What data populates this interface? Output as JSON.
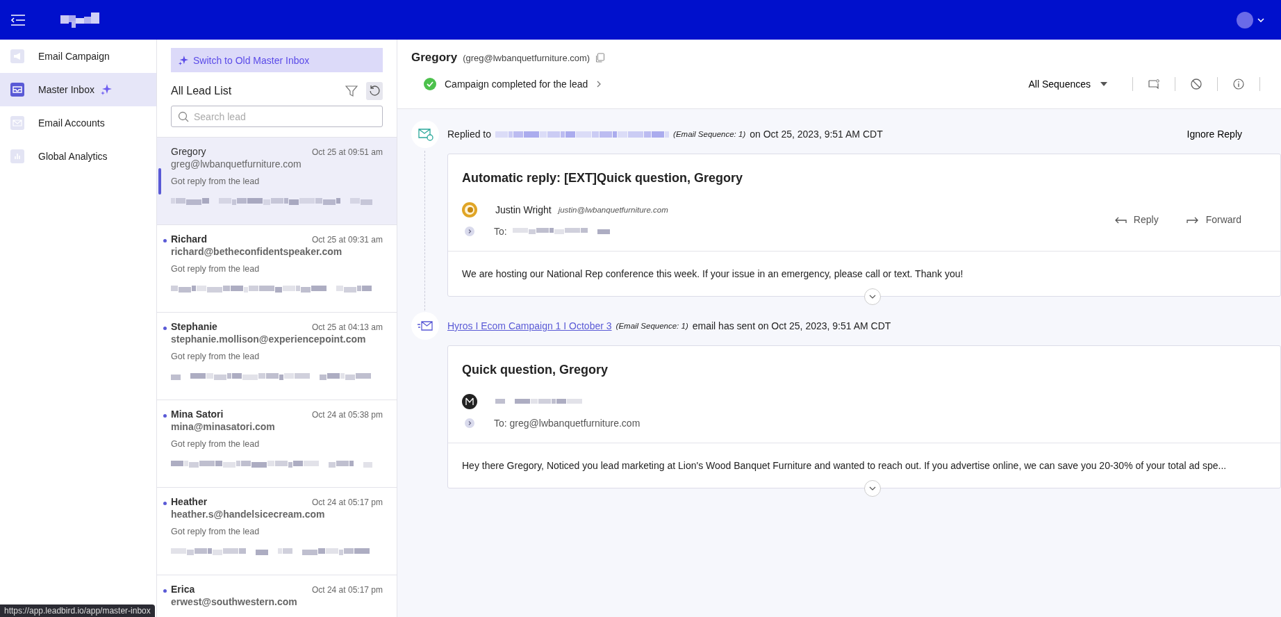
{
  "nav": [
    {
      "label": "Email Campaign",
      "selected": false,
      "sparkle": false
    },
    {
      "label": "Master Inbox",
      "selected": true,
      "sparkle": true
    },
    {
      "label": "Email Accounts",
      "selected": false,
      "sparkle": false
    },
    {
      "label": "Global Analytics",
      "selected": false,
      "sparkle": false
    }
  ],
  "lead_panel": {
    "switch_button": "Switch to Old Master Inbox",
    "title": "All Lead List",
    "search": {
      "placeholder": "Search lead"
    }
  },
  "leads": [
    {
      "name": "Gregory",
      "time": "Oct 25 at 09:51 am",
      "email": "greg@lwbanquetfurniture.com",
      "status": "Got reply from the lead",
      "selected": true,
      "unread": false
    },
    {
      "name": "Richard",
      "time": "Oct 25 at 09:31 am",
      "email": "richard@betheconfidentspeaker.com",
      "status": "Got reply from the lead",
      "selected": false,
      "unread": true
    },
    {
      "name": "Stephanie",
      "time": "Oct 25 at 04:13 am",
      "email": "stephanie.mollison@experiencepoint.com",
      "status": "Got reply from the lead",
      "selected": false,
      "unread": true
    },
    {
      "name": "Mina Satori",
      "time": "Oct 24 at 05:38 pm",
      "email": "mina@minasatori.com",
      "status": "Got reply from the lead",
      "selected": false,
      "unread": true
    },
    {
      "name": "Heather",
      "time": "Oct 24 at 05:17 pm",
      "email": "heather.s@handelsicecream.com",
      "status": "Got reply from the lead",
      "selected": false,
      "unread": true
    },
    {
      "name": "Erica",
      "time": "Oct 24 at 05:17 pm",
      "email": "erwest@southwestern.com",
      "selected": false,
      "unread": true
    }
  ],
  "lead_header": {
    "name": "Gregory",
    "email": "(greg@lwbanquetfurniture.com)",
    "campaign_status": "Campaign completed for the lead",
    "sequence_select": "All Sequences"
  },
  "timeline": [
    {
      "kind": "reply",
      "event_prefix": "Replied to",
      "sequence": "(Email Sequence: 1)",
      "event_suffix": "on Oct 25, 2023, 9:51 AM CDT",
      "action": "Ignore Reply",
      "subject": "Automatic reply: [EXT]Quick question, Gregory",
      "sender_name": "Justin Wright",
      "sender_email": "justin@lwbanquetfurniture.com",
      "to_label": "To:",
      "reply": "Reply",
      "forward": "Forward",
      "body": "We are hosting our National Rep conference this week.  If your issue in an emergency, please call or text.  Thank you!"
    },
    {
      "kind": "sent",
      "event_link": "Hyros I Ecom Campaign 1 I October 3",
      "sequence": "(Email Sequence: 1)",
      "event_suffix": "email has sent on Oct 25, 2023, 9:51 AM CDT",
      "subject": "Quick question, Gregory",
      "to_label": "To: greg@lwbanquetfurniture.com",
      "body": "Hey there Gregory, Noticed you lead marketing at Lion's Wood Banquet Furniture and wanted to reach out. If you advertise online, we can save you 20-30% of your total ad spe..."
    }
  ],
  "status_url": "https://app.leadbird.io/app/master-inbox"
}
